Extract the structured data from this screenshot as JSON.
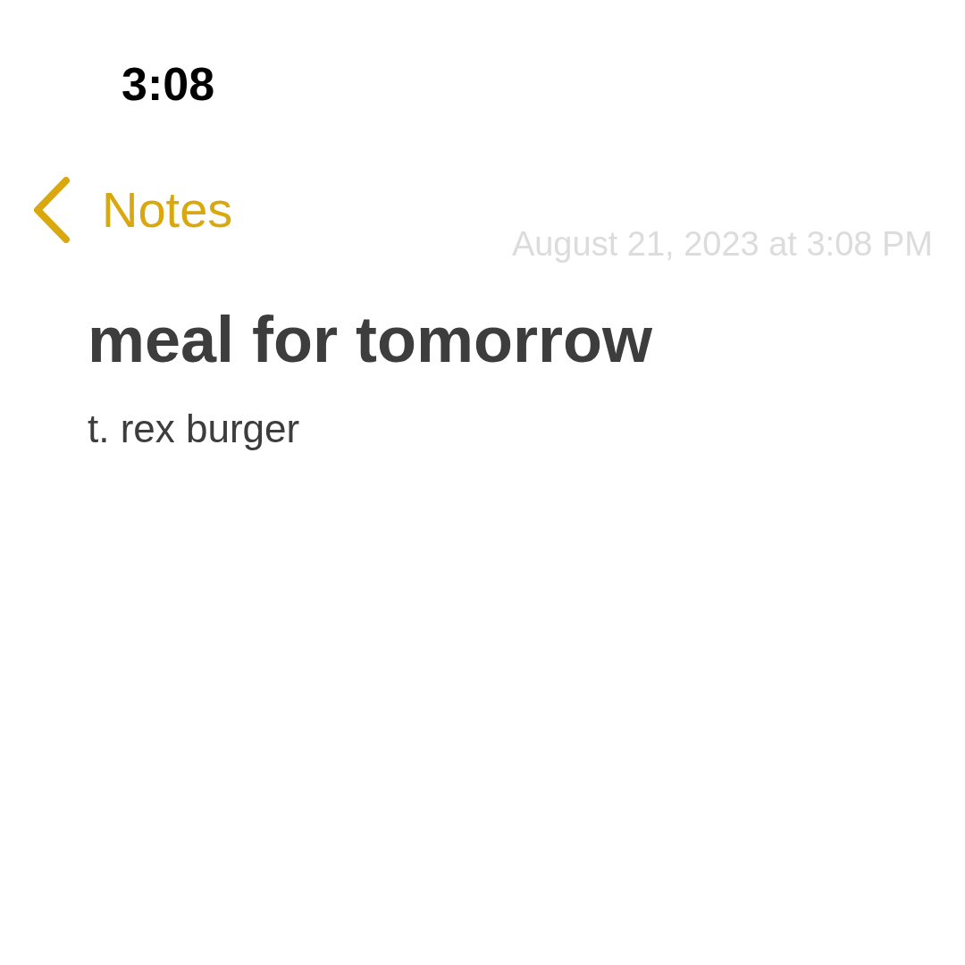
{
  "status_bar": {
    "time": "3:08"
  },
  "nav": {
    "back_label": "Notes"
  },
  "note": {
    "date": "August 21, 2023 at 3:08 PM",
    "title": "meal for tomorrow",
    "body": "t. rex burger"
  }
}
